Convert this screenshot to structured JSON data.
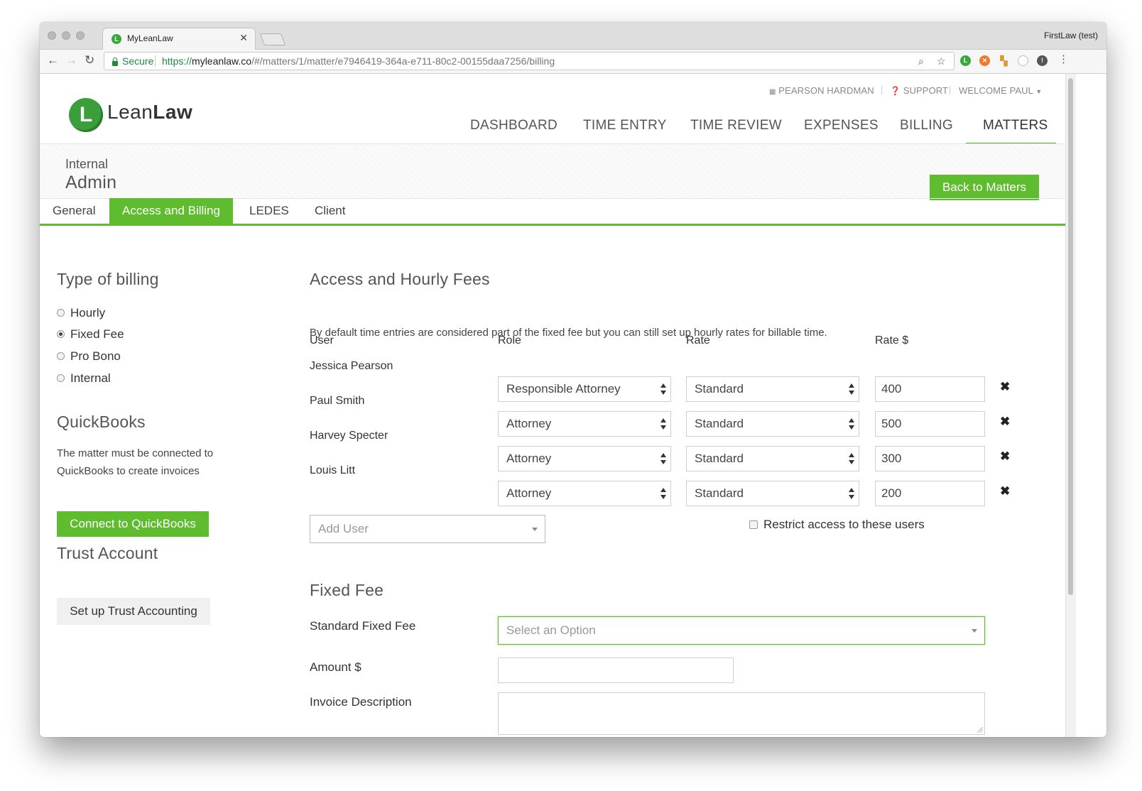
{
  "browser": {
    "tab_title": "MyLeanLaw",
    "profile": "FirstLaw (test)",
    "secure_label": "Secure",
    "url_scheme": "https://",
    "url_domain": "myleanlaw.co",
    "url_path": "/#/matters/1/matter/e7946419-364a-e711-80c2-00155daa7256/billing"
  },
  "header": {
    "firm": "PEARSON HARDMAN",
    "support": "SUPPORT",
    "welcome": "WELCOME PAUL",
    "logo_light": "Lean",
    "logo_bold": "Law",
    "nav": [
      "DASHBOARD",
      "TIME ENTRY",
      "TIME REVIEW",
      "EXPENSES",
      "BILLING",
      "MATTERS"
    ]
  },
  "matter": {
    "client": "Internal",
    "name": "Admin",
    "back_button": "Back to Matters"
  },
  "tabs": [
    "General",
    "Access and Billing",
    "LEDES",
    "Client"
  ],
  "billing_type": {
    "title": "Type of billing",
    "options": [
      "Hourly",
      "Fixed Fee",
      "Pro Bono",
      "Internal"
    ],
    "selected": "Fixed Fee"
  },
  "quickbooks": {
    "title": "QuickBooks",
    "line1": "The matter must be connected to",
    "line2": "QuickBooks to create invoices",
    "button": "Connect to QuickBooks"
  },
  "trust": {
    "title": "Trust Account",
    "button": "Set up Trust Accounting"
  },
  "access": {
    "title": "Access and Hourly Fees",
    "description": "By default time entries are considered part of the fixed fee but you can still set up hourly rates for billable time.",
    "columns": [
      "User",
      "Role",
      "Rate",
      "Rate $"
    ],
    "rows": [
      {
        "user": "Jessica Pearson",
        "role": "Responsible Attorney",
        "rate": "Standard",
        "amount": "400"
      },
      {
        "user": "Paul Smith",
        "role": "Attorney",
        "rate": "Standard",
        "amount": "500"
      },
      {
        "user": "Harvey Specter",
        "role": "Attorney",
        "rate": "Standard",
        "amount": "300"
      },
      {
        "user": "Louis Litt",
        "role": "Attorney",
        "rate": "Standard",
        "amount": "200"
      }
    ],
    "add_user_placeholder": "Add User",
    "restrict_label": "Restrict access to these users"
  },
  "fixed_fee": {
    "title": "Fixed Fee",
    "standard_label": "Standard Fixed Fee",
    "standard_placeholder": "Select an Option",
    "amount_label": "Amount $",
    "description_label": "Invoice Description"
  },
  "colors": {
    "accent": "#5fbc2f",
    "logo": "#3a9e3a"
  }
}
